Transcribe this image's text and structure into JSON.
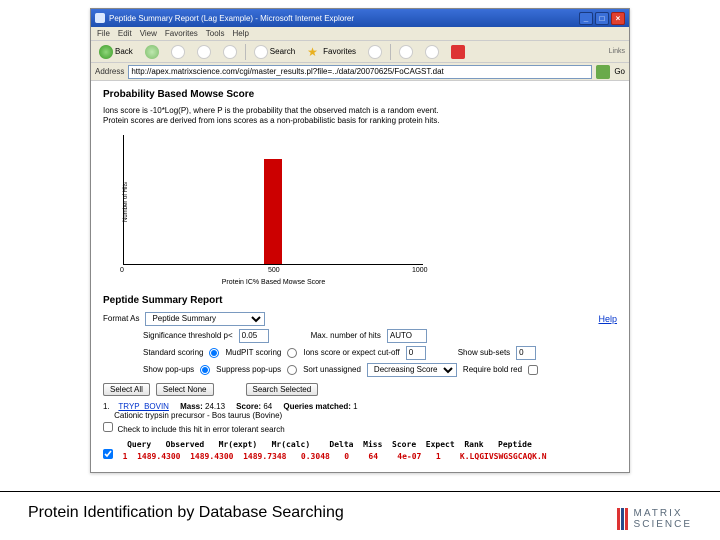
{
  "window": {
    "title": "Peptide Summary Report (Lag Example) - Microsoft Internet Explorer",
    "menus": [
      "File",
      "Edit",
      "View",
      "Favorites",
      "Tools",
      "Help"
    ],
    "toolbar": {
      "back": "Back",
      "search": "Search",
      "favorites": "Favorites",
      "links": "Links"
    },
    "address_label": "Address",
    "address_url": "http://apex.matrixscience.com/cgi/master_results.pl?file=../data/20070625/FoCAGST.dat",
    "go": "Go"
  },
  "mowse": {
    "heading": "Probability Based Mowse Score",
    "desc1": "Ions score is -10*Log(P), where P is the probability that the observed match is a random event.",
    "desc2": "Protein scores are derived from ions scores as a non-probabilistic basis for ranking protein hits."
  },
  "chart_data": {
    "type": "bar",
    "categories": [
      "500"
    ],
    "values": [
      1
    ],
    "xlabel": "Protein IC% Based Mowse Score",
    "ylabel": "Number of Hits",
    "xlim": [
      0,
      1000
    ],
    "xticks": [
      0,
      500,
      1000
    ],
    "ylim": [
      0,
      1
    ]
  },
  "summary": {
    "heading": "Peptide Summary Report",
    "format_as_label": "Format As",
    "format_as_value": "Peptide Summary",
    "help": "Help",
    "sig_label": "Significance threshold p<",
    "sig_value": "0.05",
    "max_hits_label": "Max. number of hits",
    "max_hits_value": "AUTO",
    "std_scoring_label": "Standard scoring",
    "mudpit_label": "MudPIT scoring",
    "ions_cutoff_label": "Ions score or expect cut-off",
    "ions_cutoff_value": "0",
    "subsets_label": "Show sub-sets",
    "subsets_value": "0",
    "show_popups": "Show pop-ups",
    "suppress_popups": "Suppress pop-ups",
    "sort_label": "Sort unassigned",
    "sort_value": "Decreasing Score",
    "require_bold": "Require bold red",
    "select_all": "Select All",
    "select_none": "Select None",
    "search_selected": "Search Selected"
  },
  "hits": [
    {
      "num": "1.",
      "acc": "TRYP_BOVIN",
      "mass_label": "Mass:",
      "mass": "24.13",
      "score_label": "Score:",
      "score": "64",
      "queries_label": "Queries matched:",
      "queries": "1",
      "desc": "Cationic trypsin precursor - Bos taurus (Bovine)"
    }
  ],
  "peptide_table": {
    "headers": [
      "Query",
      "Observed",
      "Mr(expt)",
      "Mr(calc)",
      "Delta",
      "Miss",
      "Score",
      "Expect",
      "Rank",
      "Peptide"
    ],
    "row": {
      "query": "1",
      "observed": "1489.4300",
      "mrexpt": "1489.4300",
      "mrcalc": "1489.7348",
      "delta": "0.3048",
      "miss": "0",
      "score": "64",
      "expect": "4e-07",
      "rank": "1",
      "peptide": "K.LQGIVSWGSGCAQK.N"
    }
  },
  "footer": {
    "text": "Protein Identification by Database Searching",
    "brand1": "MATRIX",
    "brand2": "SCIENCE"
  }
}
